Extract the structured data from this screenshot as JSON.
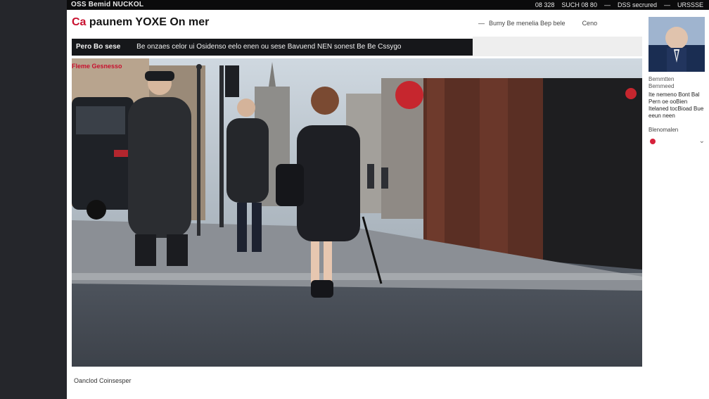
{
  "site": {
    "brand": "OSS Bemid NUCKOL",
    "top_nav": [
      "08 328",
      "SUCH 08 80",
      "—",
      "DSS secrured",
      "—",
      "URSSSE"
    ]
  },
  "header": {
    "headline_red": "Ca",
    "headline_rest": "paunem YOXE On mer",
    "links": [
      "Bumy Be menelia Bep bele",
      "Ceno"
    ]
  },
  "ticker": {
    "label": "Pero Bo sese",
    "text": "Be onzaes celor ui Osidenso eelo enen ou sese Bavuend NEN sonest Be Be Cssygo"
  },
  "article": {
    "section_label": "Fleme Gesnesso",
    "caption": "Oanclod Coinsesper"
  },
  "sidebar": {
    "meta_1": "Bemmtten",
    "meta_2": "Bemmeed",
    "text": "Ite nemeno Bont Bal Pern oe ooBien Itelaned tocBioad Bue eeun neen",
    "link": "Blenomalen"
  },
  "icons": {
    "sidebar_red_dot": "red-dot-icon",
    "sidebar_chevron": "chevron-down-icon"
  },
  "colors": {
    "accent": "#c8102e",
    "topbar_bg": "#0b0b0c",
    "ticker_bg": "#16171a"
  }
}
